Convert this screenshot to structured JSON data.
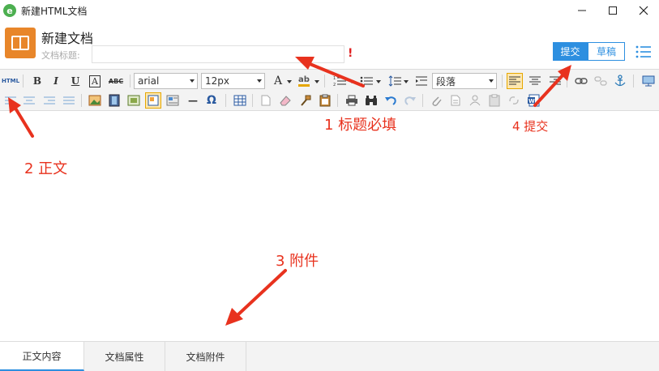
{
  "window": {
    "title": "新建HTML文档",
    "logo_glyph": "e",
    "accent": "#2d8fe0"
  },
  "header": {
    "doc_heading": "新建文档",
    "title_label": "文档标题:",
    "title_value": "",
    "required_mark": "!",
    "submit_label": "提交",
    "draft_label": "草稿"
  },
  "toolbar": {
    "html_label": "HTML",
    "bold": "B",
    "italic": "I",
    "underline": "U",
    "font_color_glyph": "A",
    "strike": "ABC",
    "font_family": "arial",
    "font_size": "12px",
    "text_size_glyph": "A",
    "highlight_glyph": "ab",
    "paragraph_format": "段落",
    "horizontal_rule_glyph": "—",
    "special_char_glyph": "Ω"
  },
  "annotations": {
    "a1": "1  标题必填",
    "a2": "2  正文",
    "a3": "3 附件",
    "a4": "4  提交"
  },
  "tabs": [
    "正文内容",
    "文档属性",
    "文档附件"
  ]
}
